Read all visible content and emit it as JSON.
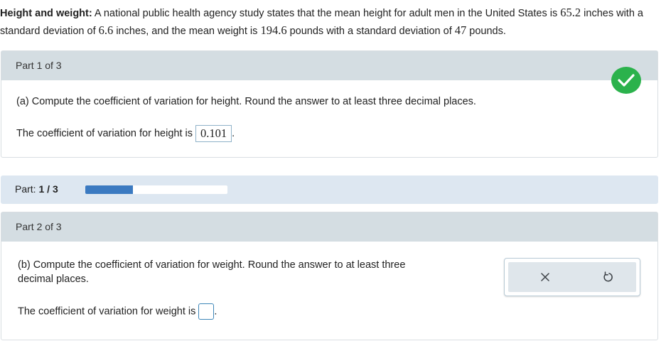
{
  "problem": {
    "title": "Height and weight:",
    "text_1": "A national public health agency study states that the mean height for adult men in the United States is",
    "mean_height": "65.2",
    "text_2": "inches with a standard deviation of",
    "sd_height": "6.6",
    "text_3": "inches, and the mean weight is",
    "mean_weight": "194.6",
    "text_4": "pounds with a standard deviation of",
    "sd_weight": "47",
    "text_5": "pounds."
  },
  "part1": {
    "header": "Part 1 of 3",
    "question": "(a) Compute the coefficient of variation for height. Round the answer to at least three decimal places.",
    "answer_prefix": "The coefficient of variation for height is",
    "answer_value": "0.101",
    "answer_suffix": ".",
    "status_icon": "checkmark-icon",
    "status_color": "#2bb24c"
  },
  "progress": {
    "label": "Part:",
    "current": "1",
    "separator": "/",
    "total": "3",
    "fraction": 0.333,
    "fill_color": "#3b7ac1"
  },
  "part2": {
    "header": "Part 2 of 3",
    "question_line1": "(b) Compute the coefficient of variation for weight. Round the answer to at least three",
    "question_line2": "decimal places.",
    "answer_prefix": "The coefficient of variation for weight is",
    "answer_value": "",
    "answer_suffix": "."
  },
  "tools": {
    "clear_icon": "close-icon",
    "reset_icon": "undo-icon"
  }
}
